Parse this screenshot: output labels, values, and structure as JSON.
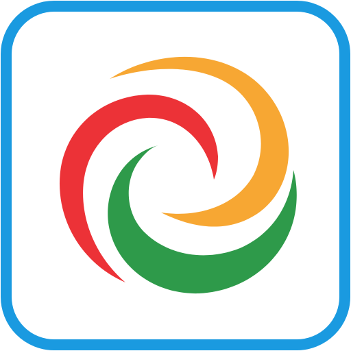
{
  "icon": {
    "name": "swirl-app-icon",
    "frame_color": "#1a9ae0",
    "background_color": "#ffffff",
    "colors": {
      "orange": "#f7a733",
      "red": "#ec3237",
      "green": "#2e9a4a"
    }
  }
}
